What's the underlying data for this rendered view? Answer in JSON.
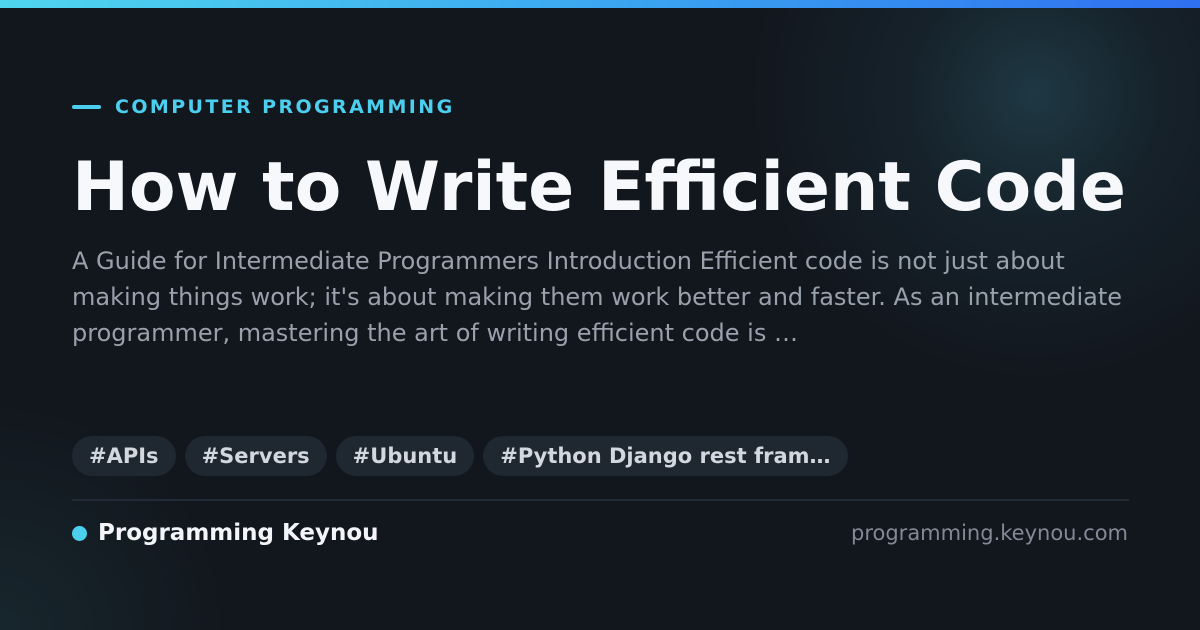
{
  "card": {
    "category": "COMPUTER PROGRAMMING",
    "title": "How to Write Efficient Code",
    "excerpt": "A Guide for Intermediate Programmers Introduction Efficient code is not just about making things work; it's about making them work better and faster. As an intermediate programmer, mastering the art of writing efficient code is …",
    "tags": [
      {
        "label": "#APIs"
      },
      {
        "label": "#Servers"
      },
      {
        "label": "#Ubuntu"
      },
      {
        "label": "#Python Django rest fram…"
      }
    ],
    "site_name": "Programming Keynou",
    "site_url": "programming.keynou.com"
  },
  "colors": {
    "accent": "#4ccfee",
    "background": "#12161d",
    "title": "#f6f8fb",
    "excerpt": "#99a1ad",
    "tag_background": "#1f2731",
    "tag_text": "#d3d8df",
    "url_text": "#818a96"
  }
}
